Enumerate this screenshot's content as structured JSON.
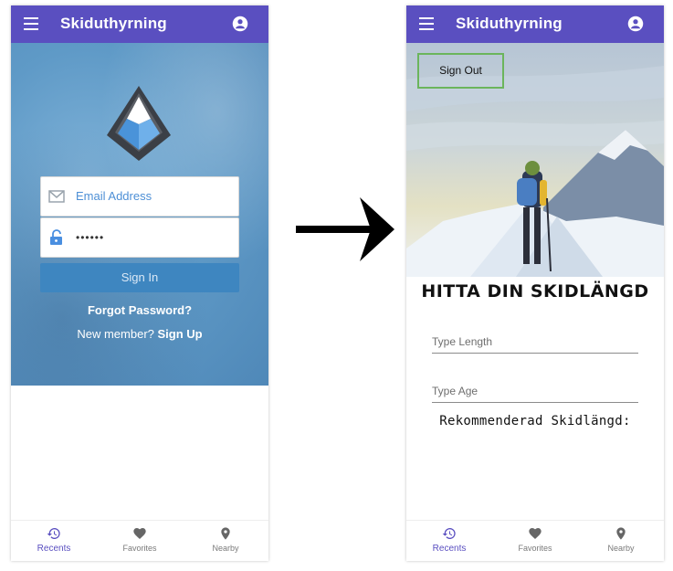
{
  "left_screen": {
    "appbar": {
      "title": "Skiduthyrning"
    },
    "login": {
      "email_placeholder": "Email Address",
      "password_value": "••••••",
      "signin_label": "Sign In",
      "forgot_label": "Forgot Password?",
      "new_member_text": "New member?",
      "signup_label": "Sign Up"
    },
    "bottom_nav": [
      {
        "label": "Recents",
        "icon": "history-icon"
      },
      {
        "label": "Favorites",
        "icon": "heart-icon"
      },
      {
        "label": "Nearby",
        "icon": "location-pin-icon"
      }
    ]
  },
  "right_screen": {
    "appbar": {
      "title": "Skiduthyrning"
    },
    "signout_label": "Sign Out",
    "headline": "HITTA DIN SKIDLÄNGD",
    "length_placeholder": "Type Length",
    "age_placeholder": "Type Age",
    "result_label": "Rekommenderad Skidlängd:",
    "bottom_nav": [
      {
        "label": "Recents",
        "icon": "history-icon"
      },
      {
        "label": "Favorites",
        "icon": "heart-icon"
      },
      {
        "label": "Nearby",
        "icon": "location-pin-icon"
      }
    ]
  },
  "colors": {
    "appbar": "#5a4fc0",
    "login_button": "#3e86c0",
    "signout_border": "#6bb55c",
    "active_nav": "#5a4fc0"
  }
}
